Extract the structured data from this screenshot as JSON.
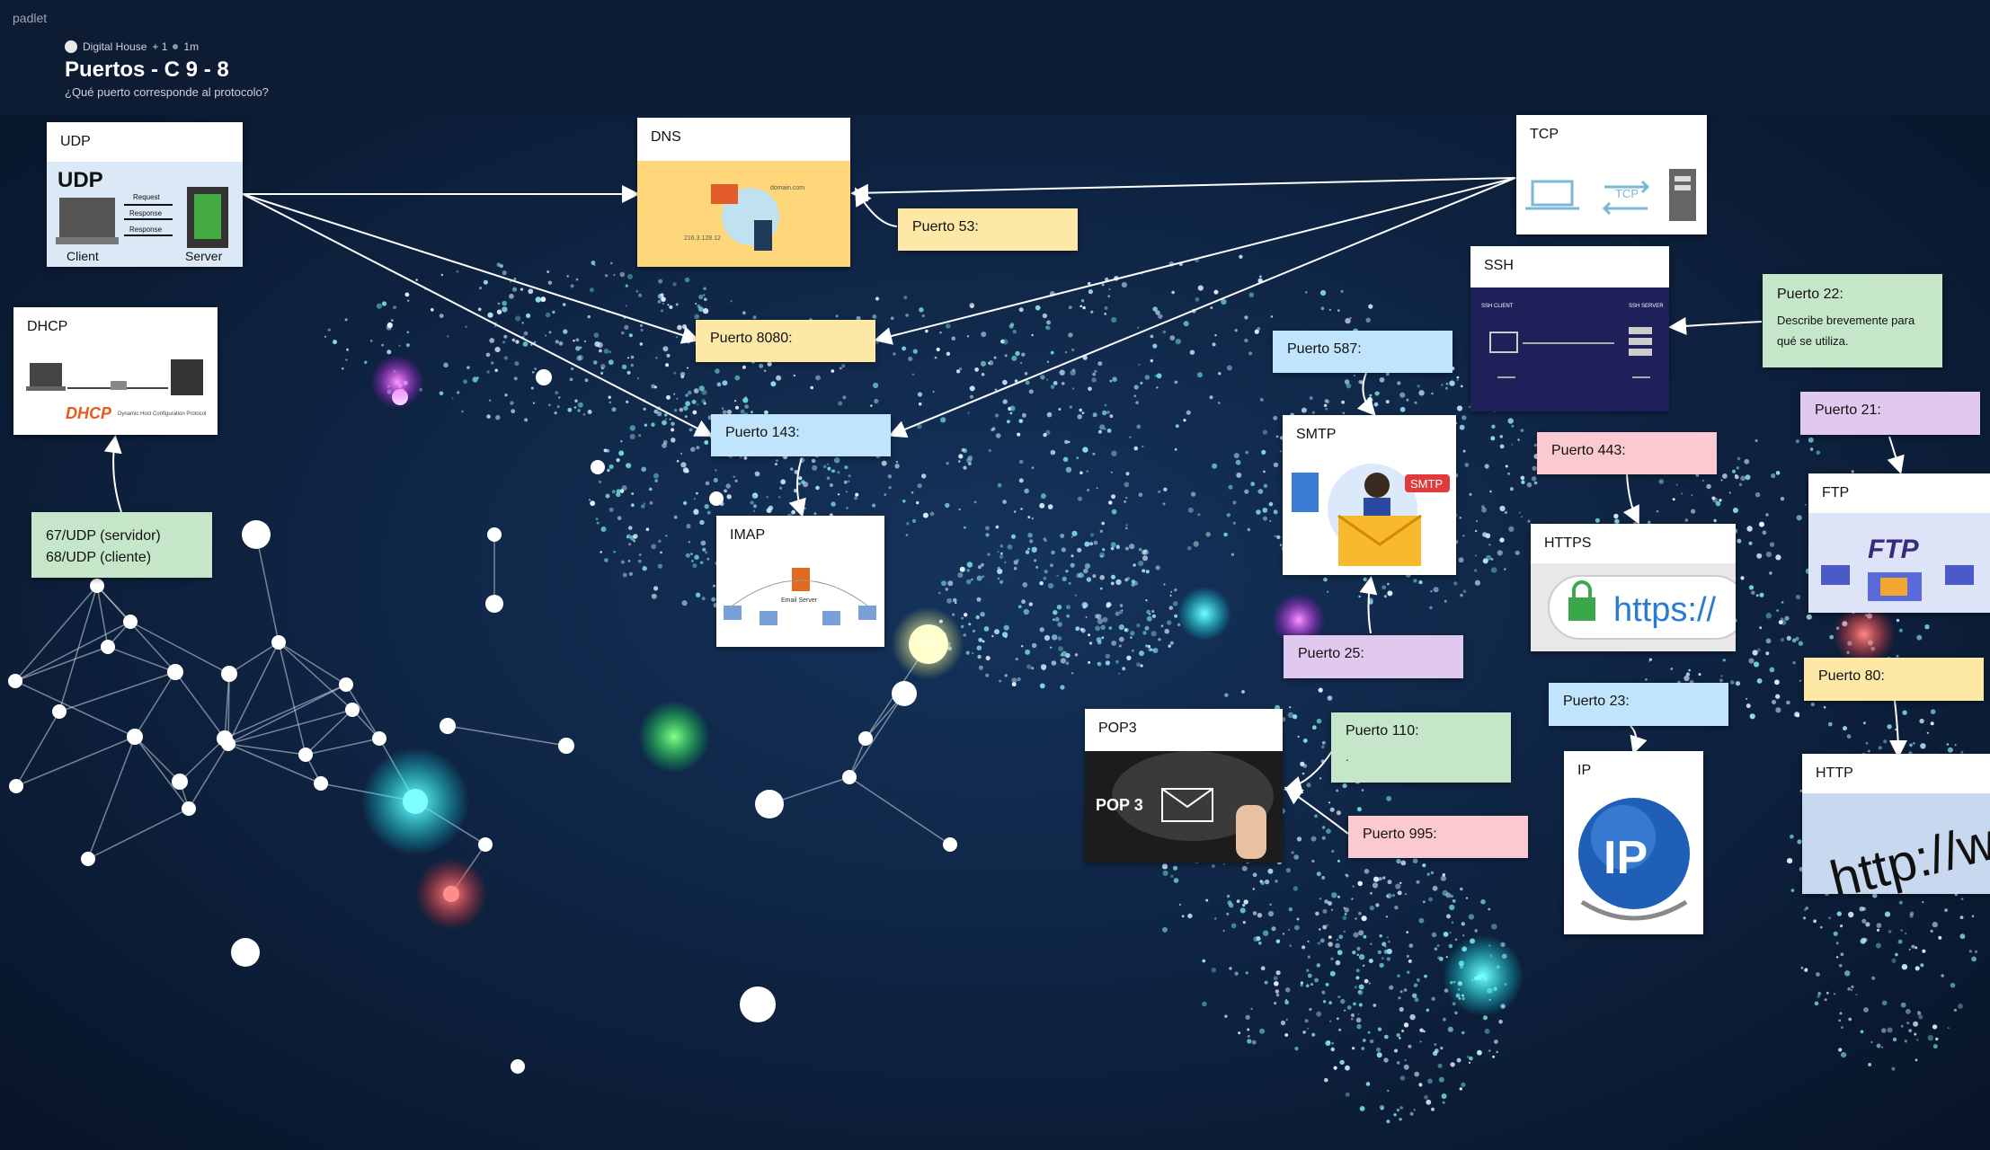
{
  "brand": "padlet",
  "header": {
    "author": "Digital House",
    "plus": "+ 1",
    "time": "1m",
    "title": "Puertos - C 9 - 8",
    "subtitle": "¿Qué puerto corresponde al protocolo?"
  },
  "cards": {
    "udp": {
      "title": "UDP",
      "heading": "UDP",
      "client": "Client",
      "server": "Server",
      "req": "Request",
      "resp1": "Response",
      "resp2": "Response"
    },
    "dhcp": {
      "title": "DHCP",
      "logo": "DHCP",
      "cap": "Dynamic Host Configuration Protocol"
    },
    "dns": {
      "title": "DNS",
      "domain": "domain.com",
      "ip": "216.3.128.12"
    },
    "tcp": {
      "title": "TCP",
      "label": "TCP"
    },
    "ssh": {
      "title": "SSH",
      "client": "SSH CLIENT",
      "server": "SSH SERVER"
    },
    "smtp": {
      "title": "SMTP",
      "badge": "SMTP"
    },
    "imap": {
      "title": "IMAP",
      "server": "Email Server"
    },
    "https": {
      "title": "HTTPS",
      "url": "https://"
    },
    "ftp": {
      "title": "FTP",
      "label": "FTP"
    },
    "pop3": {
      "title": "POP3",
      "label": "POP 3"
    },
    "ip": {
      "title": "IP",
      "label": "IP"
    },
    "http": {
      "title": "HTTP",
      "url": "http://ww"
    }
  },
  "notes": {
    "dhcp_ports": {
      "line1": "67/UDP (servidor)",
      "line2": "68/UDP (cliente)"
    },
    "p53": "Puerto 53:",
    "p8080": "Puerto 8080:",
    "p143": "Puerto 143:",
    "p587": "Puerto 587:",
    "p22": {
      "title": "Puerto 22:",
      "body": "Describe brevemente para qué se utiliza."
    },
    "p21": "Puerto 21:",
    "p443": "Puerto 443:",
    "p25": "Puerto 25:",
    "p110": {
      "title": "Puerto 110:",
      "body": "."
    },
    "p995": "Puerto 995:",
    "p23": "Puerto 23:",
    "p80": "Puerto 80:"
  },
  "colors": {
    "background": "#0b1a33",
    "note_yellow": "#fde8a6",
    "note_blue": "#bfe4fb",
    "note_green": "#c6e6c9",
    "note_pink": "#fbc9d0",
    "note_purple": "#e0c8ee"
  }
}
